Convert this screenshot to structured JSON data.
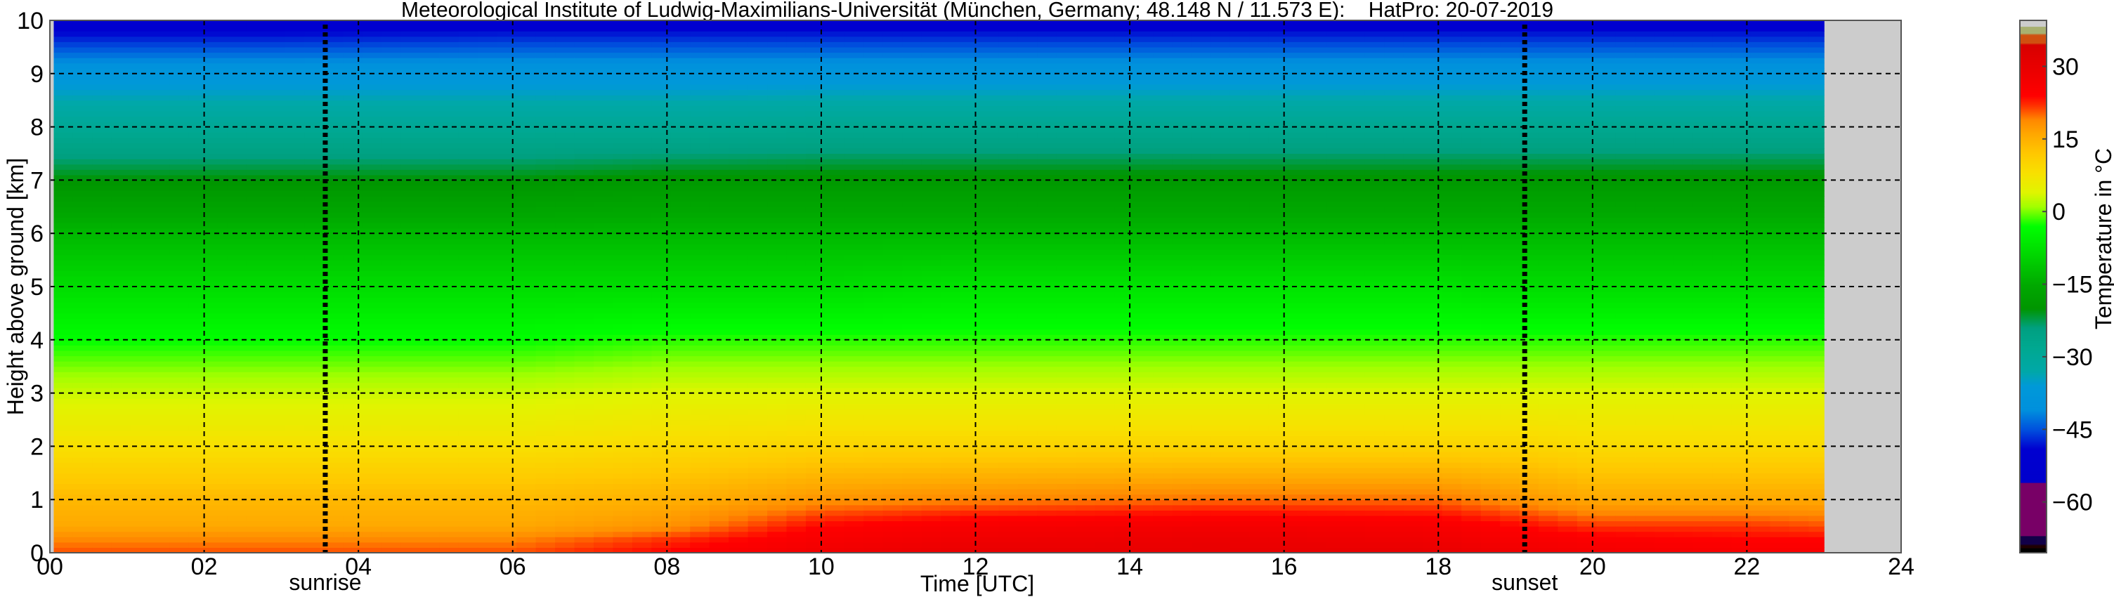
{
  "chart_data": {
    "type": "heatmap",
    "title": "Meteorological Institute of Ludwig-Maximilians-Universität (München, Germany; 48.148 N / 11.573 E):    HatPro: 20-07-2019",
    "xlabel": "Time [UTC]",
    "ylabel": "Height above ground [km]",
    "xlim": [
      0,
      24
    ],
    "ylim": [
      0,
      10
    ],
    "x_ticks": [
      "00",
      "02",
      "04",
      "06",
      "08",
      "10",
      "12",
      "14",
      "16",
      "18",
      "20",
      "22",
      "24"
    ],
    "y_ticks": [
      "0",
      "1",
      "2",
      "3",
      "4",
      "5",
      "6",
      "7",
      "8",
      "9",
      "10"
    ],
    "grid": true,
    "data_time_range_utc": [
      0.05,
      23.0
    ],
    "missing_color": "#cccccc",
    "annotations": [
      {
        "label": "sunrise",
        "time_utc": 3.57
      },
      {
        "label": "sunset",
        "time_utc": 19.12
      }
    ],
    "times_utc": [
      0,
      3,
      6,
      8,
      10,
      12,
      15,
      18,
      19,
      20,
      22,
      23
    ],
    "heights_km": [
      0,
      0.25,
      0.5,
      1,
      2,
      3,
      4,
      5,
      6,
      7,
      8,
      9,
      10
    ],
    "temperature_c": [
      [
        21,
        19,
        16,
        14,
        8,
        3,
        -3,
        -8,
        -13,
        -20,
        -29,
        -38,
        -52
      ],
      [
        21,
        19,
        16,
        14,
        8,
        3,
        -3,
        -8,
        -13,
        -20,
        -29,
        -38,
        -52
      ],
      [
        21,
        19,
        16,
        14,
        8,
        3,
        -3,
        -8,
        -13,
        -20,
        -29,
        -38,
        -51
      ],
      [
        24,
        22,
        18,
        15,
        9,
        4,
        -2,
        -8,
        -13,
        -19,
        -29,
        -38,
        -51
      ],
      [
        28,
        26,
        24,
        18,
        10,
        4,
        -2,
        -8,
        -13,
        -19,
        -28,
        -38,
        -51
      ],
      [
        30,
        28,
        26,
        19,
        10,
        4,
        -2,
        -7,
        -13,
        -19,
        -28,
        -38,
        -51
      ],
      [
        30,
        29,
        27,
        20,
        10,
        4,
        -2,
        -7,
        -13,
        -19,
        -28,
        -38,
        -51
      ],
      [
        30,
        28,
        26,
        20,
        10,
        4,
        -2,
        -7,
        -13,
        -19,
        -28,
        -38,
        -51
      ],
      [
        28,
        26,
        24,
        18,
        10,
        4,
        -2,
        -8,
        -13,
        -19,
        -28,
        -38,
        -51
      ],
      [
        27,
        25,
        22,
        16,
        9,
        4,
        -2,
        -8,
        -13,
        -19,
        -28,
        -38,
        -51
      ],
      [
        26,
        24,
        22,
        16,
        9,
        4,
        -2,
        -8,
        -13,
        -19,
        -28,
        -38,
        -51
      ],
      [
        26,
        24,
        21,
        16,
        9,
        4,
        -2,
        -8,
        -13,
        -19,
        -28,
        -38,
        -51
      ]
    ],
    "colorbar": {
      "label": "Temperature in °C",
      "range": [
        -70.5,
        39.5
      ],
      "ticks": [
        30,
        15,
        0,
        -15,
        -30,
        -45,
        -60
      ],
      "tick_labels": [
        "30",
        "15",
        "0",
        "−15",
        "−30",
        "−45",
        "−60"
      ],
      "colormap": [
        [
          -70.5,
          "#000000"
        ],
        [
          -69.6,
          "#000000"
        ],
        [
          -69.5,
          "#200000"
        ],
        [
          -68.9,
          "#200000"
        ],
        [
          -68.8,
          "#120048"
        ],
        [
          -67.1,
          "#120048"
        ],
        [
          -67,
          "#780066"
        ],
        [
          -56.1,
          "#780066"
        ],
        [
          -56,
          "#0000cc"
        ],
        [
          -49,
          "#0000d0"
        ],
        [
          -45,
          "#0050dd"
        ],
        [
          -41,
          "#0090dd"
        ],
        [
          -36,
          "#0099d8"
        ],
        [
          -33,
          "#00a8a8"
        ],
        [
          -28,
          "#00a890"
        ],
        [
          -24,
          "#00a080"
        ],
        [
          -20,
          "#009500"
        ],
        [
          -15,
          "#00aa00"
        ],
        [
          -8,
          "#00dd00"
        ],
        [
          -3,
          "#00ff00"
        ],
        [
          1,
          "#a0ff00"
        ],
        [
          4,
          "#e0f500"
        ],
        [
          8,
          "#f8e000"
        ],
        [
          12,
          "#ffc800"
        ],
        [
          16,
          "#ffa800"
        ],
        [
          19,
          "#ff8800"
        ],
        [
          22,
          "#ff3000"
        ],
        [
          24,
          "#ff0000"
        ],
        [
          30,
          "#e80000"
        ],
        [
          34.6,
          "#d60000"
        ],
        [
          34.7,
          "#d05010"
        ],
        [
          36.6,
          "#d05010"
        ],
        [
          36.7,
          "#a8b070"
        ],
        [
          38.2,
          "#a8b070"
        ],
        [
          38.3,
          "#cccccc"
        ],
        [
          39.5,
          "#cccccc"
        ]
      ]
    }
  }
}
